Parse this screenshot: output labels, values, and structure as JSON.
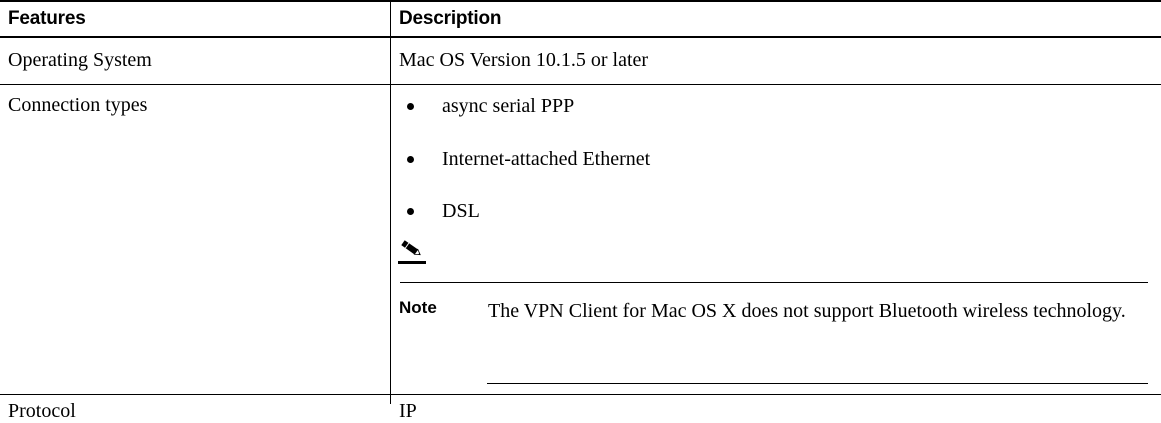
{
  "table": {
    "headers": {
      "features": "Features",
      "description": "Description"
    },
    "rows": [
      {
        "feature": "Operating System",
        "description": "Mac OS Version 10.1.5 or later"
      },
      {
        "feature": "Connection types",
        "bullets": [
          "async serial PPP",
          "Internet-attached Ethernet",
          "DSL"
        ],
        "note": {
          "icon": "pencil-icon",
          "label": "Note",
          "text": "The VPN Client for Mac OS X does not support Bluetooth wireless technology."
        }
      },
      {
        "feature": "Protocol",
        "description": "IP"
      }
    ]
  }
}
